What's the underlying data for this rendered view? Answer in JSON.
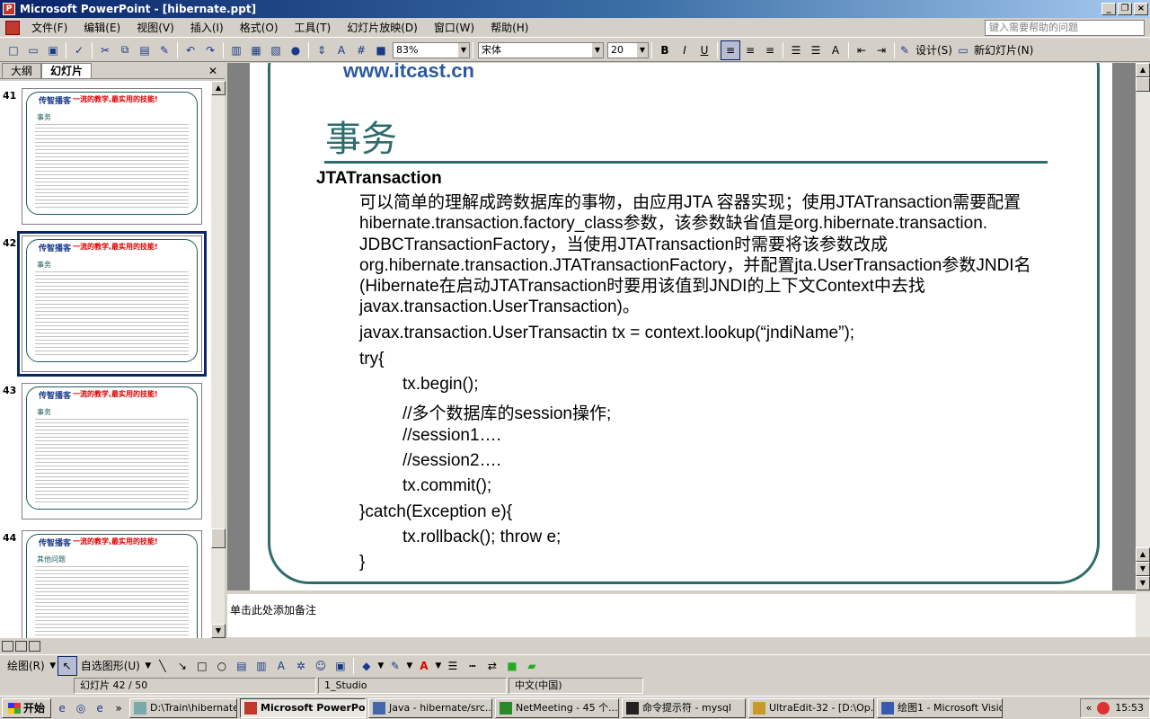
{
  "window": {
    "title": "Microsoft PowerPoint - [hibernate.ppt]"
  },
  "menu": {
    "items": [
      "文件(F)",
      "编辑(E)",
      "视图(V)",
      "插入(I)",
      "格式(O)",
      "工具(T)",
      "幻灯片放映(D)",
      "窗口(W)",
      "帮助(H)"
    ],
    "help_placeholder": "键入需要帮助的问题"
  },
  "toolbar": {
    "zoom": "83%",
    "font": "宋体",
    "font_size": "20",
    "design_label": "设计(S)",
    "new_slide_label": "新幻灯片(N)"
  },
  "left_pane": {
    "tabs": [
      "大纲",
      "幻灯片"
    ],
    "thumbs": [
      {
        "num": "41",
        "title": "事务",
        "brand": "传智播客",
        "slogan": "一流的教学,最实用的技能!"
      },
      {
        "num": "42",
        "title": "事务",
        "brand": "传智播客",
        "slogan": "一流的教学,最实用的技能!"
      },
      {
        "num": "43",
        "title": "事务",
        "brand": "传智播客",
        "slogan": "一流的教学,最实用的技能!"
      },
      {
        "num": "44",
        "title": "其他问题",
        "brand": "传智播客",
        "slogan": "一流的教学,最实用的技能!"
      }
    ]
  },
  "slide": {
    "logo": "www.itcast.cn",
    "title": "事务",
    "subhead": "JTATransaction",
    "paragraph": "可以简单的理解成跨数据库的事物，由应用JTA 容器实现；使用JTATransaction需要配置hibernate.transaction.factory_class参数，该参数缺省值是org.hibernate.transaction. JDBCTransactionFactory，当使用JTATransaction时需要将该参数改成org.hibernate.transaction.JTATransactionFactory，并配置jta.UserTransaction参数JNDI名(Hibernate在启动JTATransaction时要用该值到JNDI的上下文Context中去找javax.transaction.UserTransaction)。",
    "code": [
      "javax.transaction.UserTransactin tx = context.lookup(“jndiName”);",
      "try{",
      "tx.begin();",
      "//多个数据库的session操作;",
      "//session1….",
      "//session2….",
      "tx.commit();",
      "}catch(Exception e){",
      "tx.rollback(); throw e;",
      "}"
    ]
  },
  "notes": {
    "placeholder": "单击此处添加备注"
  },
  "drawing": {
    "draw_label": "绘图(R)",
    "autoshape_label": "自选图形(U)"
  },
  "status": {
    "slide": "幻灯片 42 / 50",
    "design": "1_Studio",
    "language": "中文(中国)"
  },
  "taskbar": {
    "start": "开始",
    "tasks": [
      "D:\\Train\\hibernate\\v...",
      "Microsoft PowerPoint",
      "Java - hibernate/src...",
      "NetMeeting - 45 个...",
      "命令提示符 - mysql",
      "UltraEdit-32 - [D:\\Op...",
      "绘图1 - Microsoft Visio"
    ],
    "clock": "15:53"
  }
}
